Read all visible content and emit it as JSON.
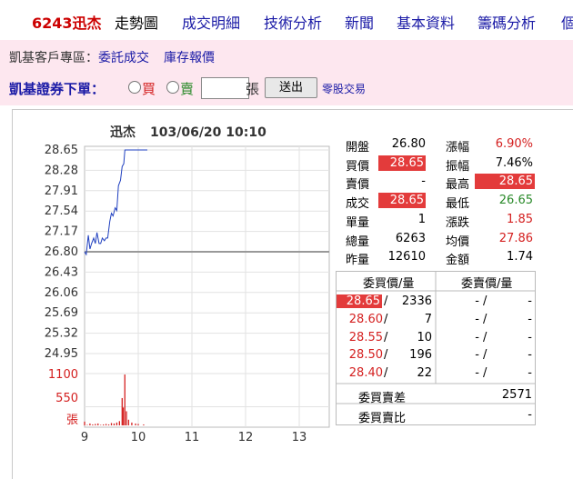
{
  "nav": {
    "stock": "6243迅杰",
    "items": [
      "走勢圖",
      "成交明細",
      "技術分析",
      "新聞",
      "基本資料",
      "籌碼分析",
      "個"
    ]
  },
  "member_bar": {
    "label": "凱基客戶專區：",
    "links": [
      "委託成交",
      "庫存報價"
    ]
  },
  "order_bar": {
    "title": "凱基證券下單：",
    "buy_label": "買",
    "sell_label": "賣",
    "quantity_value": "",
    "unit_label": "張",
    "send_label": "送出",
    "odd_lot_label": "零股交易"
  },
  "chart_header": {
    "name": "迅杰",
    "datetime": "103/06/20 10:10"
  },
  "chart_data": {
    "type": "line",
    "x_ticks": [
      "9",
      "10",
      "11",
      "12",
      "13"
    ],
    "y_ticks": [
      "28.65",
      "28.28",
      "27.91",
      "27.54",
      "27.17",
      "26.80",
      "26.43",
      "26.06",
      "25.69",
      "25.32",
      "24.95"
    ],
    "ylim": [
      24.95,
      28.65
    ],
    "reference_price": 26.8,
    "price_series": {
      "x": [
        9.0,
        9.03,
        9.07,
        9.1,
        9.13,
        9.17,
        9.2,
        9.23,
        9.27,
        9.3,
        9.33,
        9.37,
        9.4,
        9.43,
        9.47,
        9.5,
        9.53,
        9.57,
        9.6,
        9.63,
        9.67,
        9.7,
        9.73,
        9.75,
        9.8,
        9.9,
        10.0,
        10.17
      ],
      "y": [
        26.8,
        26.75,
        27.1,
        26.85,
        26.95,
        27.05,
        26.95,
        27.15,
        26.95,
        26.95,
        27.05,
        27.0,
        27.05,
        27.05,
        27.35,
        27.5,
        27.45,
        27.6,
        27.55,
        28.0,
        28.1,
        28.35,
        28.4,
        28.65,
        28.65,
        28.65,
        28.65,
        28.65
      ]
    },
    "volume_ticks": [
      "1100",
      "550",
      "張"
    ],
    "volume_max": 1100,
    "volume_series": {
      "x": [
        9.0,
        9.05,
        9.1,
        9.15,
        9.2,
        9.25,
        9.3,
        9.35,
        9.4,
        9.45,
        9.5,
        9.55,
        9.6,
        9.65,
        9.7,
        9.72,
        9.75,
        9.78,
        9.82,
        9.88,
        9.95,
        10.0,
        10.1
      ],
      "y": [
        80,
        10,
        40,
        20,
        30,
        40,
        10,
        20,
        30,
        20,
        50,
        40,
        60,
        90,
        580,
        380,
        1080,
        300,
        120,
        60,
        40,
        30,
        20
      ]
    }
  },
  "quote": {
    "rows": [
      {
        "l1": "開盤",
        "v1": "26.80",
        "l2": "漲幅",
        "v2": "6.90%"
      },
      {
        "l1": "買價",
        "v1": "28.65",
        "l2": "振幅",
        "v2": "7.46%"
      },
      {
        "l1": "賣價",
        "v1": "-",
        "l2": "最高",
        "v2": "28.65"
      },
      {
        "l1": "成交",
        "v1": "28.65",
        "l2": "最低",
        "v2": "26.65"
      },
      {
        "l1": "單量",
        "v1": "1",
        "l2": "漲跌",
        "v2": "1.85"
      },
      {
        "l1": "總量",
        "v1": "6263",
        "l2": "均價",
        "v2": "27.86"
      },
      {
        "l1": "昨量",
        "v1": "12610",
        "l2": "金額",
        "v2": "1.74"
      }
    ]
  },
  "order_book": {
    "bid_header": "委買價/量",
    "ask_header": "委賣價/量",
    "rows": [
      {
        "bp": "28.65",
        "bq": "2336",
        "ap": "-",
        "aq": "-"
      },
      {
        "bp": "28.60",
        "bq": "7",
        "ap": "-",
        "aq": "-"
      },
      {
        "bp": "28.55",
        "bq": "10",
        "ap": "-",
        "aq": "-"
      },
      {
        "bp": "28.50",
        "bq": "196",
        "ap": "-",
        "aq": "-"
      },
      {
        "bp": "28.40",
        "bq": "22",
        "ap": "-",
        "aq": "-"
      }
    ],
    "diff_label": "委買賣差",
    "diff_value": "2571",
    "ratio_label": "委買賣比",
    "ratio_value": "-"
  },
  "colors": {
    "up": "#d42020",
    "down": "#2a8a2a",
    "link": "#1a1aa6",
    "highlight": "#e33b3b"
  }
}
